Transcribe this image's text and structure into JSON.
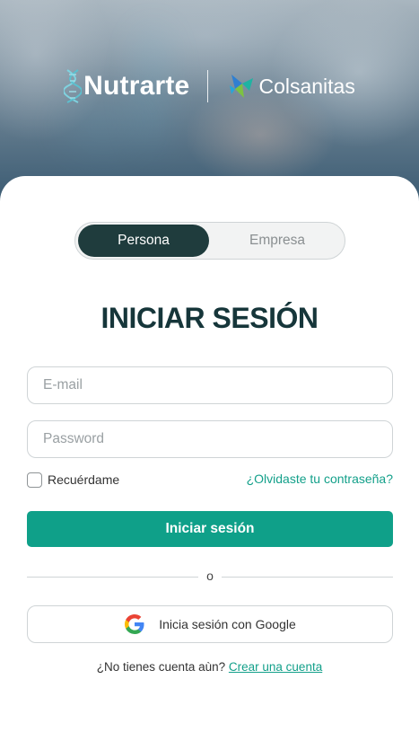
{
  "header": {
    "brand_primary": "Nutrarte",
    "brand_secondary": "Colsanitas"
  },
  "tabs": {
    "active": "Persona",
    "inactive": "Empresa"
  },
  "title": "INICIAR SESIÓN",
  "form": {
    "email_placeholder": "E-mail",
    "password_placeholder": "Password",
    "remember_label": "Recuérdame",
    "remember_checked": false,
    "forgot_link": "¿Olvidaste tu contraseña?",
    "submit_label": "Iniciar sesión",
    "separator": "o",
    "google_label": "Inicia sesión con Google"
  },
  "footer": {
    "prompt": "¿No tienes cuenta aùn?",
    "link": "Crear una cuenta"
  },
  "colors": {
    "accent": "#0fa089",
    "dark": "#1f3c3d",
    "title": "#16363a",
    "link": "#13a08a"
  },
  "icons": [
    "dna-icon",
    "colsanitas-logo-icon",
    "google-icon"
  ]
}
